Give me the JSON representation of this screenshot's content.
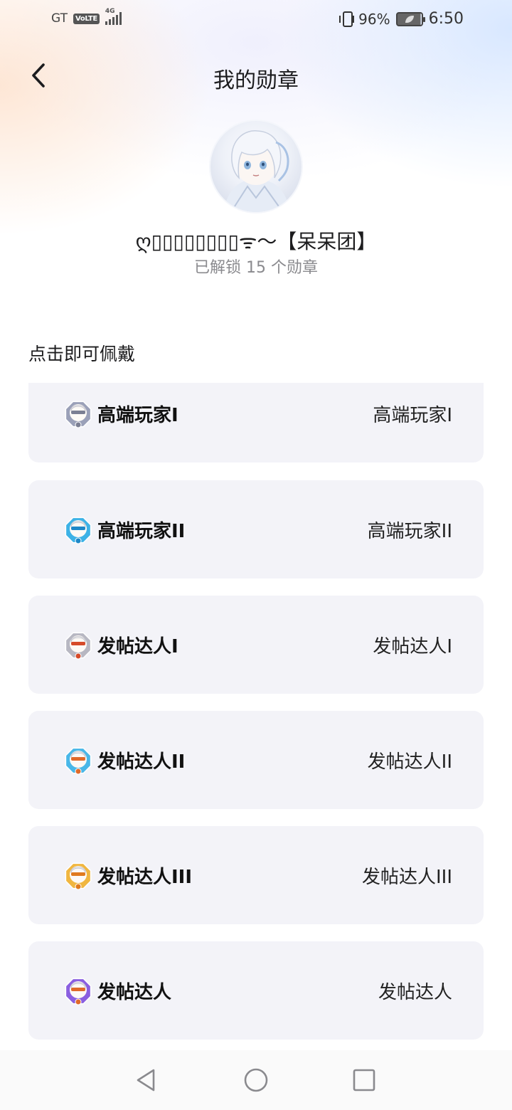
{
  "status_bar": {
    "carrier": "GT",
    "volte": "VoLTE",
    "network": "4G",
    "battery_percent": "96%",
    "time": "6:50"
  },
  "header": {
    "title": "我的勋章",
    "back_icon": "chevron-left-icon"
  },
  "profile": {
    "nickname": "ღ▯▯▯▯▯▯▯▯ᯤ〜【呆呆团】",
    "unlock_summary": "已解锁 15 个勋章"
  },
  "section": {
    "title": "点击即可佩戴"
  },
  "badges": [
    {
      "name": "高端玩家I",
      "status": "高端玩家I",
      "color": "#9aa0b8",
      "accent": "#7b7f93"
    },
    {
      "name": "高端玩家II",
      "status": "高端玩家II",
      "color": "#3db2e6",
      "accent": "#1e88c8"
    },
    {
      "name": "发帖达人I",
      "status": "发帖达人I",
      "color": "#b7b7c2",
      "accent": "#d64b2a"
    },
    {
      "name": "发帖达人II",
      "status": "发帖达人II",
      "color": "#49b7e8",
      "accent": "#e06a2a"
    },
    {
      "name": "发帖达人III",
      "status": "发帖达人III",
      "color": "#f0b640",
      "accent": "#e07a1e"
    },
    {
      "name": "发帖达人",
      "status": "发帖达人",
      "color": "#8a5fe0",
      "accent": "#e06a2a"
    }
  ],
  "colors": {
    "card_background": "#f3f3f8",
    "secondary_text": "#8a8a8e"
  },
  "navigation_bar": {
    "icons": [
      "nav-back-icon",
      "nav-home-icon",
      "nav-recent-apps-icon"
    ]
  }
}
